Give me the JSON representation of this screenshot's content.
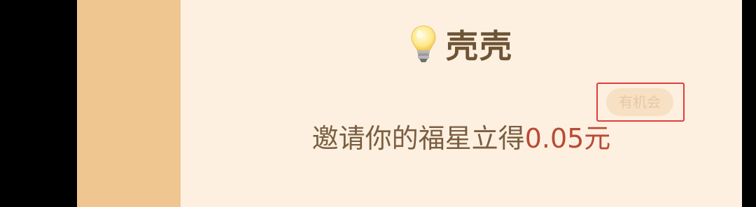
{
  "header": {
    "icon": "lightbulb-icon",
    "title": "壳壳"
  },
  "badge": {
    "label": "有机会",
    "highlight_color": "#e23b3b"
  },
  "invite": {
    "text": "邀请你的福星立得",
    "amount": "0.05元",
    "amount_color": "#b94a35"
  },
  "colors": {
    "background": "#000000",
    "card_border": "#efc690",
    "card_fill": "#fdf0e0",
    "title": "#6e5335"
  }
}
